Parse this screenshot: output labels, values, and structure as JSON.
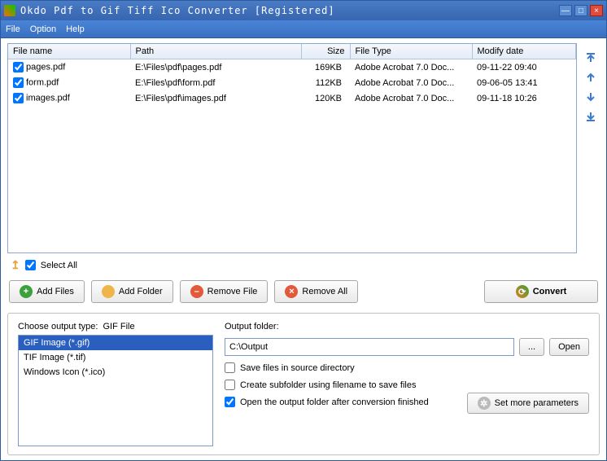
{
  "window": {
    "title": "Okdo Pdf to Gif  Tiff  Ico Converter [Registered]"
  },
  "menu": {
    "file": "File",
    "option": "Option",
    "help": "Help"
  },
  "columns": {
    "filename": "File name",
    "path": "Path",
    "size": "Size",
    "filetype": "File Type",
    "modify": "Modify date"
  },
  "files": [
    {
      "name": "pages.pdf",
      "path": "E:\\Files\\pdf\\pages.pdf",
      "size": "169KB",
      "type": "Adobe Acrobat 7.0 Doc...",
      "date": "09-11-22 09:40",
      "checked": true
    },
    {
      "name": "form.pdf",
      "path": "E:\\Files\\pdf\\form.pdf",
      "size": "112KB",
      "type": "Adobe Acrobat 7.0 Doc...",
      "date": "09-06-05 13:41",
      "checked": true
    },
    {
      "name": "images.pdf",
      "path": "E:\\Files\\pdf\\images.pdf",
      "size": "120KB",
      "type": "Adobe Acrobat 7.0 Doc...",
      "date": "09-11-18 10:26",
      "checked": true
    }
  ],
  "selectall": {
    "label": "Select All",
    "checked": true
  },
  "buttons": {
    "addfiles": "Add Files",
    "addfolder": "Add Folder",
    "removefile": "Remove File",
    "removeall": "Remove All",
    "convert": "Convert",
    "browse": "...",
    "open": "Open",
    "setparams": "Set more parameters"
  },
  "output": {
    "choose_label": "Choose output type:",
    "current_type": "GIF File",
    "types": [
      {
        "label": "GIF Image (*.gif)",
        "selected": true
      },
      {
        "label": "TIF Image (*.tif)",
        "selected": false
      },
      {
        "label": "Windows Icon (*.ico)",
        "selected": false
      }
    ],
    "folder_label": "Output folder:",
    "folder_value": "C:\\Output",
    "opt_save_source": {
      "label": "Save files in source directory",
      "checked": false
    },
    "opt_subfolder": {
      "label": "Create subfolder using filename to save files",
      "checked": false
    },
    "opt_open_after": {
      "label": "Open the output folder after conversion finished",
      "checked": true
    }
  }
}
